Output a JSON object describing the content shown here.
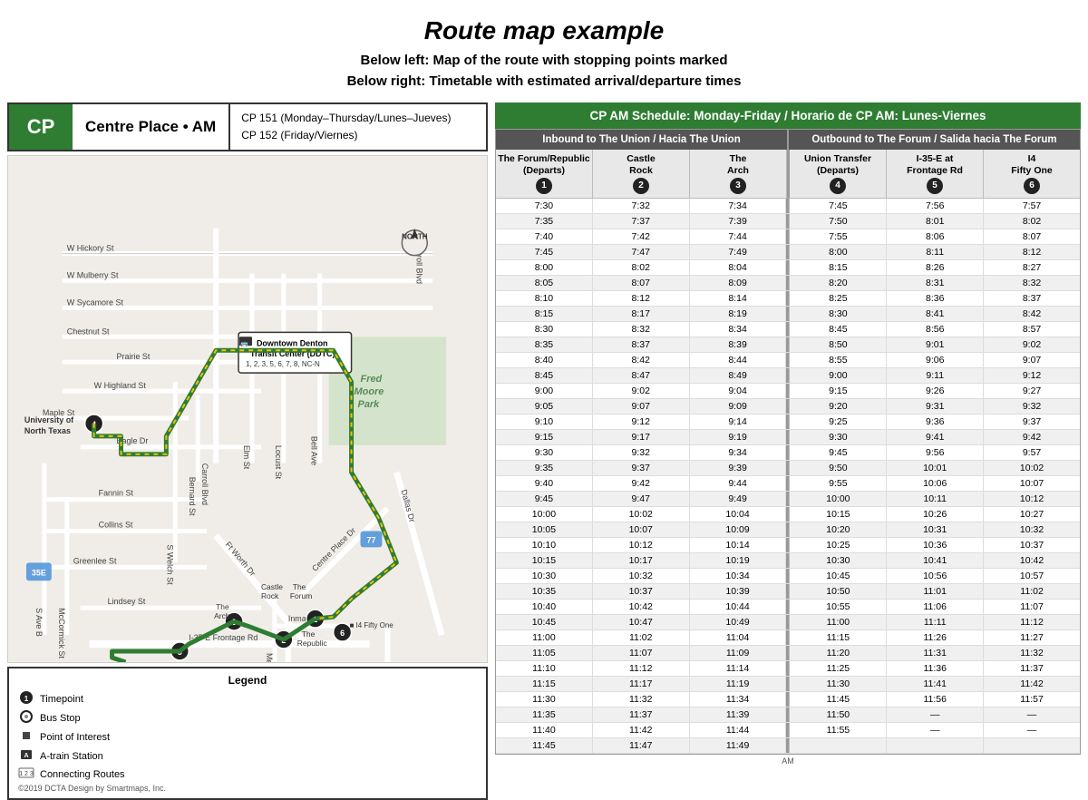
{
  "page": {
    "title": "Route map example",
    "subtitle_left": "Below left:",
    "subtitle_left_text": " Map of the route with stopping points marked",
    "subtitle_right": "Below right:",
    "subtitle_right_text": " Timetable with estimated arrival/departure times"
  },
  "route_header": {
    "tag": "CP",
    "name": "Centre Place • AM",
    "line1": "CP 151 (Monday–Thursday/Lunes–Jueves)",
    "line2": "CP 152 (Friday/Viernes)"
  },
  "timetable": {
    "header": "CP AM Schedule: Monday-Friday / Horario de CP AM: Lunes-Viernes",
    "inbound_label": "Inbound to The Union / Hacia The Union",
    "outbound_label": "Outbound to The Forum / Salida hacia The Forum",
    "columns": [
      {
        "name": "The Forum/Republic\n(Departs)",
        "num": "1"
      },
      {
        "name": "Castle\nRock",
        "num": "2"
      },
      {
        "name": "The\nArch",
        "num": "3"
      },
      {
        "name": "Union Transfer\n(Departs)",
        "num": "4"
      },
      {
        "name": "I-35-E at\nFrontage Rd",
        "num": "5"
      },
      {
        "name": "I4\nFifty One",
        "num": "6"
      }
    ],
    "rows": [
      [
        "7:30",
        "7:32",
        "7:34",
        "7:45",
        "7:56",
        "7:57"
      ],
      [
        "7:35",
        "7:37",
        "7:39",
        "7:50",
        "8:01",
        "8:02"
      ],
      [
        "7:40",
        "7:42",
        "7:44",
        "7:55",
        "8:06",
        "8:07"
      ],
      [
        "7:45",
        "7:47",
        "7:49",
        "8:00",
        "8:11",
        "8:12"
      ],
      [
        "8:00",
        "8:02",
        "8:04",
        "8:15",
        "8:26",
        "8:27"
      ],
      [
        "8:05",
        "8:07",
        "8:09",
        "8:20",
        "8:31",
        "8:32"
      ],
      [
        "8:10",
        "8:12",
        "8:14",
        "8:25",
        "8:36",
        "8:37"
      ],
      [
        "8:15",
        "8:17",
        "8:19",
        "8:30",
        "8:41",
        "8:42"
      ],
      [
        "8:30",
        "8:32",
        "8:34",
        "8:45",
        "8:56",
        "8:57"
      ],
      [
        "8:35",
        "8:37",
        "8:39",
        "8:50",
        "9:01",
        "9:02"
      ],
      [
        "8:40",
        "8:42",
        "8:44",
        "8:55",
        "9:06",
        "9:07"
      ],
      [
        "8:45",
        "8:47",
        "8:49",
        "9:00",
        "9:11",
        "9:12"
      ],
      [
        "9:00",
        "9:02",
        "9:04",
        "9:15",
        "9:26",
        "9:27"
      ],
      [
        "9:05",
        "9:07",
        "9:09",
        "9:20",
        "9:31",
        "9:32"
      ],
      [
        "9:10",
        "9:12",
        "9:14",
        "9:25",
        "9:36",
        "9:37"
      ],
      [
        "9:15",
        "9:17",
        "9:19",
        "9:30",
        "9:41",
        "9:42"
      ],
      [
        "9:30",
        "9:32",
        "9:34",
        "9:45",
        "9:56",
        "9:57"
      ],
      [
        "9:35",
        "9:37",
        "9:39",
        "9:50",
        "10:01",
        "10:02"
      ],
      [
        "9:40",
        "9:42",
        "9:44",
        "9:55",
        "10:06",
        "10:07"
      ],
      [
        "9:45",
        "9:47",
        "9:49",
        "10:00",
        "10:11",
        "10:12"
      ],
      [
        "10:00",
        "10:02",
        "10:04",
        "10:15",
        "10:26",
        "10:27"
      ],
      [
        "10:05",
        "10:07",
        "10:09",
        "10:20",
        "10:31",
        "10:32"
      ],
      [
        "10:10",
        "10:12",
        "10:14",
        "10:25",
        "10:36",
        "10:37"
      ],
      [
        "10:15",
        "10:17",
        "10:19",
        "10:30",
        "10:41",
        "10:42"
      ],
      [
        "10:30",
        "10:32",
        "10:34",
        "10:45",
        "10:56",
        "10:57"
      ],
      [
        "10:35",
        "10:37",
        "10:39",
        "10:50",
        "11:01",
        "11:02"
      ],
      [
        "10:40",
        "10:42",
        "10:44",
        "10:55",
        "11:06",
        "11:07"
      ],
      [
        "10:45",
        "10:47",
        "10:49",
        "11:00",
        "11:11",
        "11:12"
      ],
      [
        "11:00",
        "11:02",
        "11:04",
        "11:15",
        "11:26",
        "11:27"
      ],
      [
        "11:05",
        "11:07",
        "11:09",
        "11:20",
        "11:31",
        "11:32"
      ],
      [
        "11:10",
        "11:12",
        "11:14",
        "11:25",
        "11:36",
        "11:37"
      ],
      [
        "11:15",
        "11:17",
        "11:19",
        "11:30",
        "11:41",
        "11:42"
      ],
      [
        "11:30",
        "11:32",
        "11:34",
        "11:45",
        "11:56",
        "11:57"
      ],
      [
        "11:35",
        "11:37",
        "11:39",
        "11:50",
        "—",
        "—"
      ],
      [
        "11:40",
        "11:42",
        "11:44",
        "11:55",
        "—",
        "—"
      ],
      [
        "11:45",
        "11:47",
        "11:49",
        "",
        "",
        ""
      ]
    ]
  },
  "legend": {
    "title": "Legend",
    "items": [
      {
        "icon": "circle-filled",
        "label": "Timepoint"
      },
      {
        "icon": "circle-outline",
        "label": "Bus Stop"
      },
      {
        "icon": "square-filled",
        "label": "Point of Interest"
      },
      {
        "icon": "a-train",
        "label": "A-train Station"
      },
      {
        "icon": "connecting",
        "label": "Connecting Routes"
      }
    ]
  },
  "copyright": "©2019 DCTA\nDesign by Smartmaps, Inc."
}
